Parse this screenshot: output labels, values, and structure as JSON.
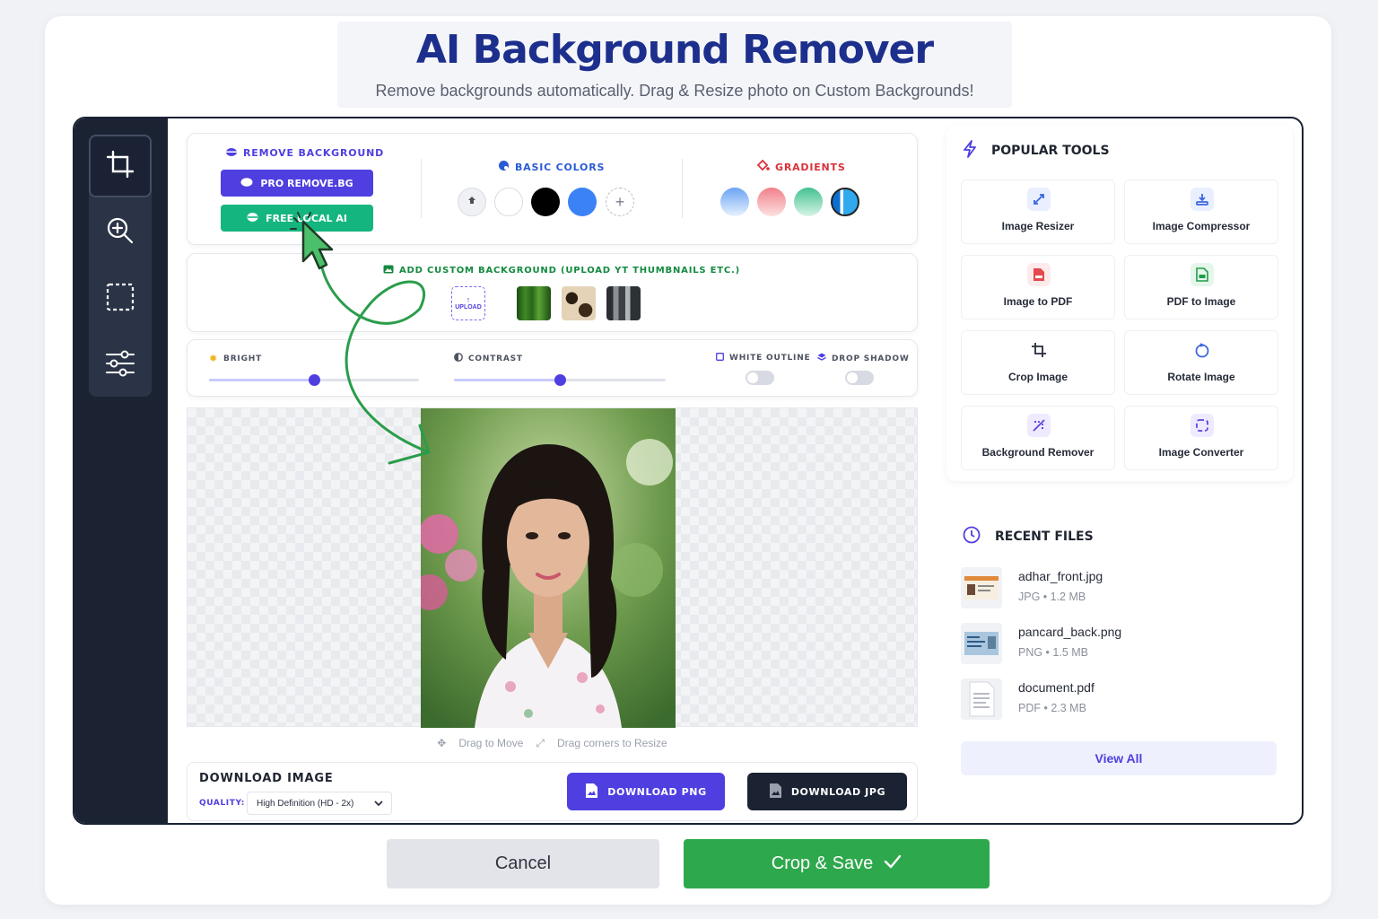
{
  "header": {
    "title": "AI Background Remover",
    "subtitle": "Remove backgrounds automatically. Drag & Resize photo on Custom Backgrounds!"
  },
  "sidebar": {
    "tools": [
      {
        "icon": "crop-icon",
        "active": true
      },
      {
        "icon": "zoom-in-icon",
        "active": false
      },
      {
        "icon": "selection-icon",
        "active": false
      },
      {
        "icon": "sliders-icon",
        "active": false
      }
    ]
  },
  "remove_bg": {
    "label": "REMOVE BACKGROUND",
    "pro_button": "PRO REMOVE.BG",
    "free_button": "FREE LOCAL AI"
  },
  "basic_colors": {
    "label": "BASIC COLORS",
    "swatches": [
      "transparent",
      "#ffffff",
      "#000000",
      "#3b82f6"
    ]
  },
  "gradients": {
    "label": "GRADIENTS",
    "colors": [
      "#9fc4f5",
      "#f5a3a5",
      "#7fd8b3",
      "#1a8fe3"
    ]
  },
  "custom_bg": {
    "label": "ADD CUSTOM BACKGROUND (UPLOAD YT THUMBNAILS ETC.)",
    "upload_label": "UPLOAD"
  },
  "adjustments": {
    "bright_label": "BRIGHT",
    "bright_value": 0.5,
    "contrast_label": "CONTRAST",
    "contrast_value": 0.5,
    "white_outline_label": "WHITE OUTLINE",
    "white_outline_on": false,
    "drop_shadow_label": "DROP SHADOW",
    "drop_shadow_on": false
  },
  "canvas": {
    "hint_move": "Drag to Move",
    "hint_resize": "Drag corners to Resize"
  },
  "download": {
    "title": "DOWNLOAD IMAGE",
    "quality_label": "QUALITY:",
    "quality_value": "High Definition (HD - 2x)",
    "png_button": "DOWNLOAD PNG",
    "jpg_button": "DOWNLOAD JPG"
  },
  "popular_tools": {
    "title": "POPULAR TOOLS",
    "items": [
      {
        "label": "Image Resizer",
        "icon": "resize-icon"
      },
      {
        "label": "Image Compressor",
        "icon": "compress-icon"
      },
      {
        "label": "Image to PDF",
        "icon": "pdf-file-icon"
      },
      {
        "label": "PDF to Image",
        "icon": "image-file-icon"
      },
      {
        "label": "Crop Image",
        "icon": "crop-icon"
      },
      {
        "label": "Rotate Image",
        "icon": "rotate-icon"
      },
      {
        "label": "Background Remover",
        "icon": "magic-wand-icon"
      },
      {
        "label": "Image Converter",
        "icon": "convert-icon"
      }
    ]
  },
  "recent_files": {
    "title": "RECENT FILES",
    "files": [
      {
        "name": "adhar_front.jpg",
        "meta": "JPG • 1.2 MB"
      },
      {
        "name": "pancard_back.png",
        "meta": "PNG • 1.5 MB"
      },
      {
        "name": "document.pdf",
        "meta": "PDF • 2.3 MB"
      }
    ],
    "view_all": "View All"
  },
  "footer": {
    "cancel": "Cancel",
    "save": "Crop & Save"
  },
  "colors": {
    "brand_purple": "#4f3fe0",
    "brand_green": "#15b57f",
    "save_green": "#2ea84d",
    "title_navy": "#1c2f8c",
    "sidebar_dark": "#1b2333"
  }
}
